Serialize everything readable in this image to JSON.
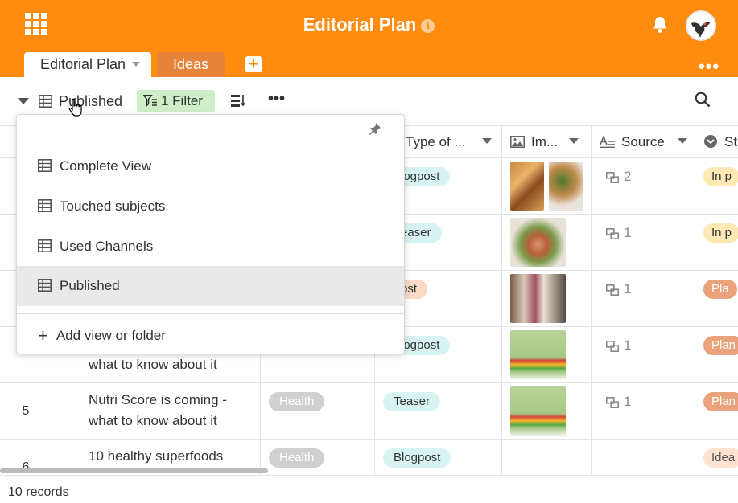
{
  "app": {
    "title": "Editorial Plan"
  },
  "tabs": [
    {
      "label": "Editorial Plan",
      "active": true
    },
    {
      "label": "Ideas",
      "active": false
    }
  ],
  "toolbar": {
    "current_view": "Published",
    "filter_label": "1 Filter"
  },
  "columns": {
    "type": "Type of ...",
    "image": "Im...",
    "source": "Source",
    "status": "St"
  },
  "rows": [
    {
      "num": "",
      "title": "",
      "category": "",
      "type": "Blogpost",
      "type_visible": "logpost",
      "source_count": "2",
      "status": "In p",
      "status_style": "yellow"
    },
    {
      "num": "",
      "title": "",
      "category": "",
      "type": "Teaser",
      "type_visible": "easer",
      "source_count": "1",
      "status": "In p",
      "status_style": "yellow"
    },
    {
      "num": "",
      "title": "",
      "category": "",
      "type": "Post",
      "type_visible": "ost",
      "source_count": "1",
      "status": "Pla",
      "status_style": "orange"
    },
    {
      "num": "",
      "title": "what to know about it",
      "category": "",
      "type": "Blogpost",
      "type_visible": "logpost",
      "source_count": "1",
      "status": "Plan",
      "status_style": "orange"
    },
    {
      "num": "5",
      "title": "Nutri Score is coming - what to know about it",
      "category": "Health",
      "type": "Teaser",
      "type_visible": "Teaser",
      "source_count": "1",
      "status": "Plan",
      "status_style": "orange"
    },
    {
      "num": "6",
      "title": "10 healthy superfoods",
      "category": "Health",
      "type": "Blogpost",
      "type_visible": "Blogpost",
      "source_count": "",
      "status": "Idea",
      "status_style": "idea"
    }
  ],
  "footer": {
    "records": "10 records"
  },
  "dropdown": {
    "items": [
      {
        "label": "Complete View",
        "selected": false
      },
      {
        "label": "Touched subjects",
        "selected": false
      },
      {
        "label": "Used Channels",
        "selected": false
      },
      {
        "label": "Published",
        "selected": true
      }
    ],
    "add_label": "Add view or folder"
  },
  "colors": {
    "brand": "#fe8c0f",
    "filter_bg": "#cdeec6"
  }
}
